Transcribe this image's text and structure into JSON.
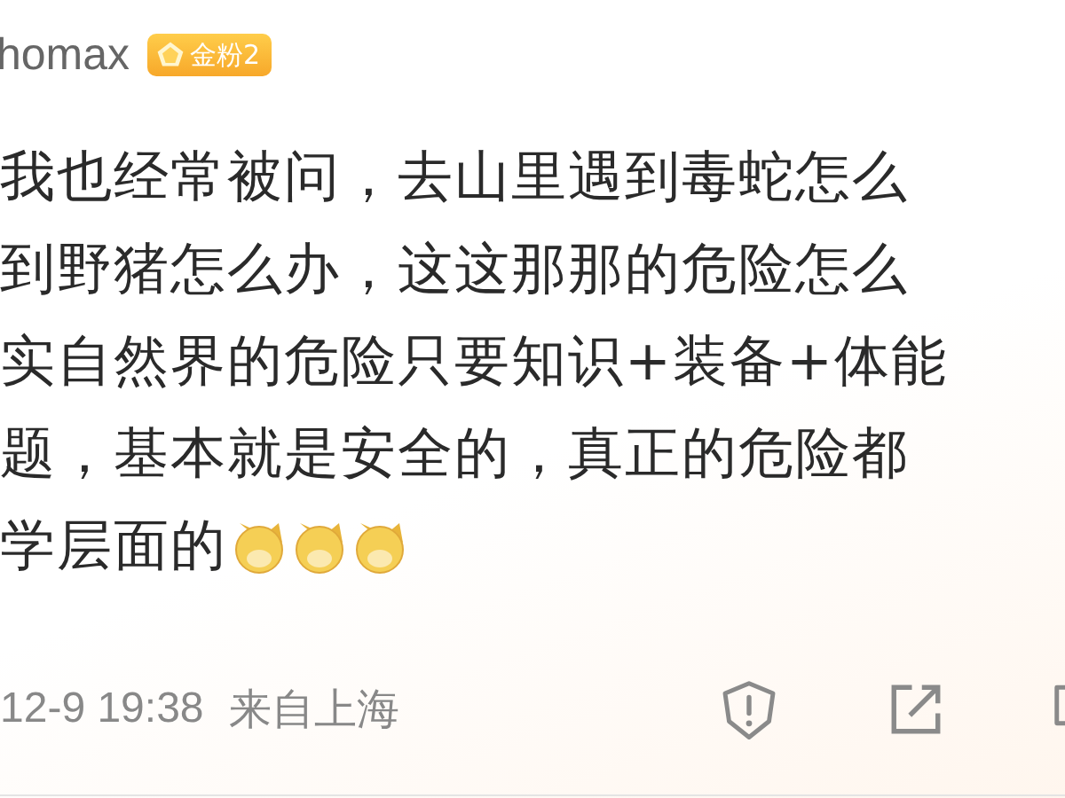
{
  "user": {
    "name": "homax",
    "badge": "金粉2"
  },
  "comment": {
    "lines": [
      "我也经常被问，去山里遇到毒蛇怎么",
      "到野猪怎么办，这这那那的危险怎么",
      "实自然界的危险只要知识+装备+体能",
      "题，基本就是安全的，真正的危险都",
      "学层面的"
    ]
  },
  "footer": {
    "time": "12-9 19:38",
    "location": "来自上海"
  }
}
